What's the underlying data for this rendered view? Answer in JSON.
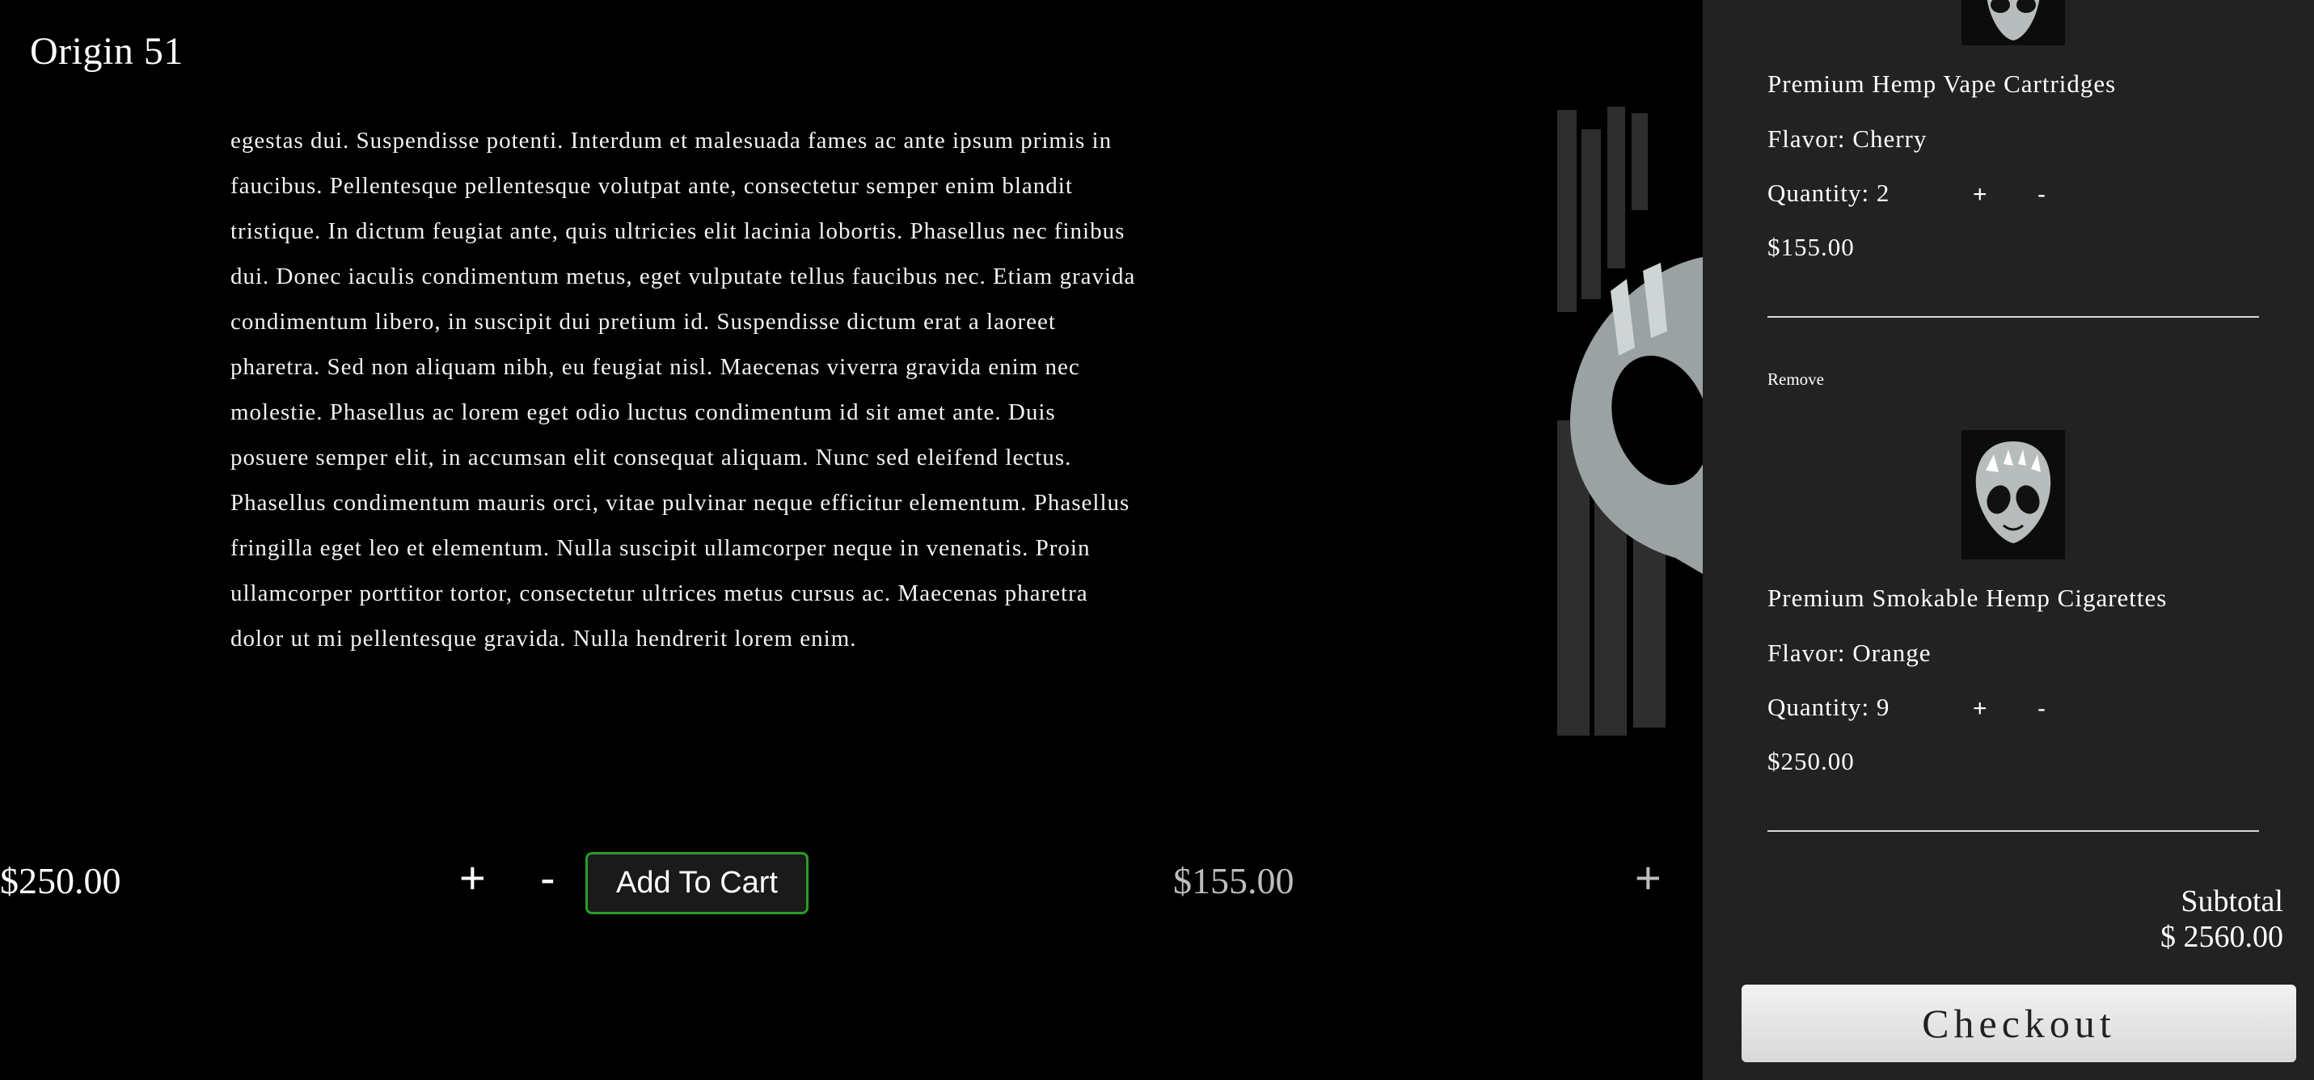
{
  "brand": "Origin 51",
  "description": "egestas dui. Suspendisse potenti. Interdum et malesuada fames ac ante ipsum primis in faucibus. Pellentesque pellentesque volutpat ante, consectetur semper enim blandit tristique. In dictum feugiat ante, quis ultricies elit lacinia lobortis. Phasellus nec finibus dui. Donec iaculis condimentum metus, eget vulputate tellus faucibus nec. Etiam gravida condimentum libero, in suscipit dui pretium id. Suspendisse dictum erat a laoreet pharetra. Sed non aliquam nibh, eu feugiat nisl. Maecenas viverra gravida enim nec molestie. Phasellus ac lorem eget odio luctus condimentum id sit amet ante. Duis posuere semper elit, in accumsan elit consequat aliquam. Nunc sed eleifend lectus. Phasellus condimentum mauris orci, vitae pulvinar neque efficitur elementum. Phasellus fringilla eget leo et elementum. Nulla suscipit ullamcorper neque in venenatis. Proin ullamcorper porttitor tortor, consectetur ultrices metus cursus ac. Maecenas pharetra dolor ut mi pellentesque gravida. Nulla hendrerit lorem enim.",
  "product_left": {
    "price": "$250.00",
    "plus": "+",
    "minus": "-",
    "add_label": "Add To Cart"
  },
  "product_mid": {
    "price": "$155.00",
    "plus": "+"
  },
  "cart": {
    "items": [
      {
        "name": "Premium Hemp Vape Cartridges",
        "flavor": "Flavor: Cherry",
        "quantity": "Quantity: 2",
        "plus": "+",
        "minus": "-",
        "price": "$155.00"
      },
      {
        "remove": "Remove",
        "name": "Premium Smokable Hemp Cigarettes",
        "flavor": "Flavor: Orange",
        "quantity": "Quantity: 9",
        "plus": "+",
        "minus": "-",
        "price": "$250.00"
      }
    ],
    "subtotal_label": "Subtotal",
    "subtotal_value": "$ 2560.00",
    "checkout_label": "Checkout"
  },
  "colors": {
    "background": "#000000",
    "cart_panel": "#222222",
    "add_border": "#2a9c2a"
  }
}
